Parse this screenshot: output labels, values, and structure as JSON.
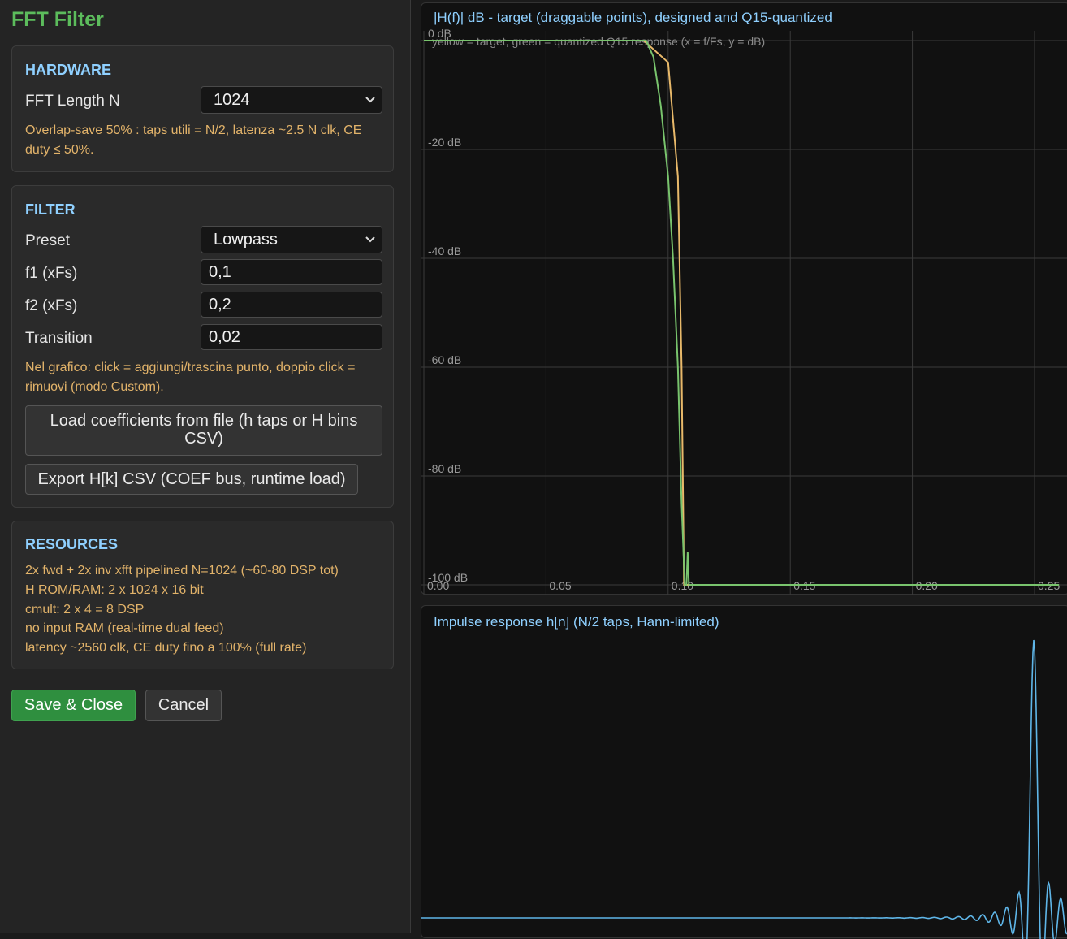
{
  "app": {
    "title": "FFT Filter"
  },
  "hardware": {
    "title": "HARDWARE",
    "fft_length_label": "FFT Length N",
    "fft_length_value": "1024",
    "note": "Overlap-save 50% : taps utili = N/2, latenza ~2.5 N clk, CE duty ≤ 50%."
  },
  "filter": {
    "title": "FILTER",
    "preset_label": "Preset",
    "preset_value": "Lowpass",
    "f1_label": "f1 (xFs)",
    "f1_value": "0,1",
    "f2_label": "f2 (xFs)",
    "f2_value": "0,2",
    "transition_label": "Transition",
    "transition_value": "0,02",
    "note": "Nel grafico: click = aggiungi/trascina punto, doppio click = rimuovi (modo Custom).",
    "load_button": "Load coefficients from file (h taps or H bins CSV)",
    "export_button": "Export H[k] CSV (COEF bus, runtime load)"
  },
  "resources": {
    "title": "RESOURCES",
    "lines": [
      "2x fwd + 2x inv xfft pipelined N=1024 (~60-80 DSP tot)",
      "H ROM/RAM: 2 x 1024 x 16 bit",
      "cmult: 2 x 4 = 8 DSP",
      "no input RAM (real-time dual feed)",
      "latency ~2560 clk, CE duty fino a 100% (full rate)"
    ]
  },
  "actions": {
    "save": "Save & Close",
    "cancel": "Cancel"
  },
  "chart_data": [
    {
      "type": "line",
      "title": "|H(f)| dB - target (draggable points), designed and Q15-quantized",
      "subtitle": "yellow = target, green = quantized Q15 response  (x = f/Fs, y = dB)",
      "xlim": [
        0,
        0.26
      ],
      "ylim": [
        -100,
        0
      ],
      "x_ticks": [
        "0.00",
        "0.05",
        "0.10",
        "0.15",
        "0.20",
        "0.25"
      ],
      "y_ticks": [
        "0 dB",
        "-20 dB",
        "-40 dB",
        "-60 dB",
        "-80 dB",
        "-100 dB"
      ],
      "grid": true,
      "colors": {
        "target": "#e8b96a",
        "quantized": "#79c46d"
      },
      "series": [
        {
          "x": [
            0,
            0.09,
            0.1,
            0.104,
            0.1055,
            0.1065,
            0.26
          ],
          "y": [
            0,
            0,
            -4,
            -25,
            -60,
            -100,
            -100
          ]
        },
        {
          "x": [
            0,
            0.091,
            0.094,
            0.097,
            0.1,
            0.102,
            0.104,
            0.1055,
            0.1068,
            0.1075,
            0.108,
            0.1085,
            0.109,
            0.26
          ],
          "y": [
            0,
            0,
            -3,
            -12,
            -25,
            -40,
            -60,
            -85,
            -100,
            -100,
            -94,
            -100,
            -100,
            -100
          ]
        }
      ]
    },
    {
      "type": "line",
      "title": "Impulse response h[n] (N/2 taps, Hann-limited)",
      "colors": {
        "h": "#5fb6e8"
      },
      "peak_normalized": 1.0
    }
  ]
}
